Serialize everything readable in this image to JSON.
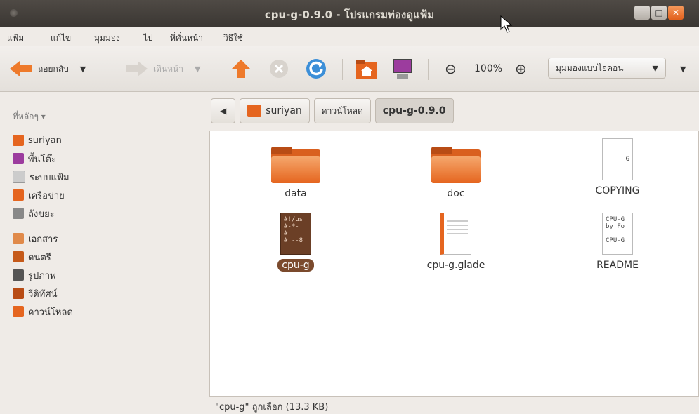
{
  "window": {
    "title": "cpu-g-0.9.0 - โปรแกรมท่องดูแฟ้ม"
  },
  "menu": [
    "แฟ้ม",
    "แก้ไข",
    "มุมมอง",
    "ไป",
    "ที่คั่นหน้า",
    "วิธีใช้"
  ],
  "toolbar": {
    "back_label": "ถอยกลับ",
    "forward_label": "เดินหน้า",
    "zoom_value": "100%",
    "view_mode": "มุมมองแบบไอคอน"
  },
  "sidebar": {
    "header": "ที่หลักๆ",
    "items": [
      {
        "label": "suriyan",
        "icon": "home-folder-icon"
      },
      {
        "label": "พื้นโต๊ะ",
        "icon": "desktop-icon"
      },
      {
        "label": "ระบบแฟ้ม",
        "icon": "filesystem-icon"
      },
      {
        "label": "เครือข่าย",
        "icon": "network-icon"
      },
      {
        "label": "ถังขยะ",
        "icon": "trash-icon"
      },
      {
        "label": "เอกสาร",
        "icon": "documents-icon"
      },
      {
        "label": "ดนตรี",
        "icon": "music-icon"
      },
      {
        "label": "รูปภาพ",
        "icon": "pictures-icon"
      },
      {
        "label": "วีดิทัศน์",
        "icon": "videos-icon"
      },
      {
        "label": "ดาวน์โหลด",
        "icon": "downloads-icon"
      }
    ]
  },
  "pathbar": [
    "suriyan",
    "ดาวน์โหลด",
    "cpu-g-0.9.0"
  ],
  "files": [
    {
      "name": "data",
      "type": "folder"
    },
    {
      "name": "doc",
      "type": "folder"
    },
    {
      "name": "COPYING",
      "type": "text",
      "preview": "G"
    },
    {
      "name": "cpu-g",
      "type": "script",
      "preview": "#!/us\n#-*-\n#\n# --8",
      "selected": true
    },
    {
      "name": "cpu-g.glade",
      "type": "glade"
    },
    {
      "name": "README",
      "type": "text",
      "preview": "CPU-G\nby Fo\n\nCPU-G"
    }
  ],
  "status": "\"cpu-g\" ถูกเลือก (13.3 KB)"
}
